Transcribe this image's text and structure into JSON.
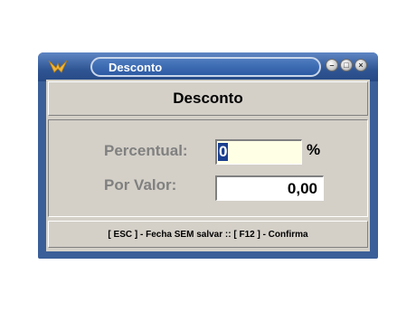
{
  "window": {
    "title": "Desconto",
    "controls": {
      "minimize": "–",
      "maximize": "□",
      "close": "×"
    }
  },
  "header": {
    "title": "Desconto"
  },
  "form": {
    "percentual": {
      "label": "Percentual:",
      "value": "0",
      "suffix": "%"
    },
    "por_valor": {
      "label": "Por Valor:",
      "value": "0,00"
    }
  },
  "footer": {
    "hint": "[ ESC ] - Fecha SEM salvar :: [ F12 ] - Confirma"
  },
  "colors": {
    "titlebar": "#2f5593",
    "client": "#d4d0c8",
    "label_gray": "#808080",
    "percent_field_bg": "#ffffe6",
    "selection": "#1a3f8f"
  },
  "icons": {
    "app": "eagle-logo-icon"
  }
}
